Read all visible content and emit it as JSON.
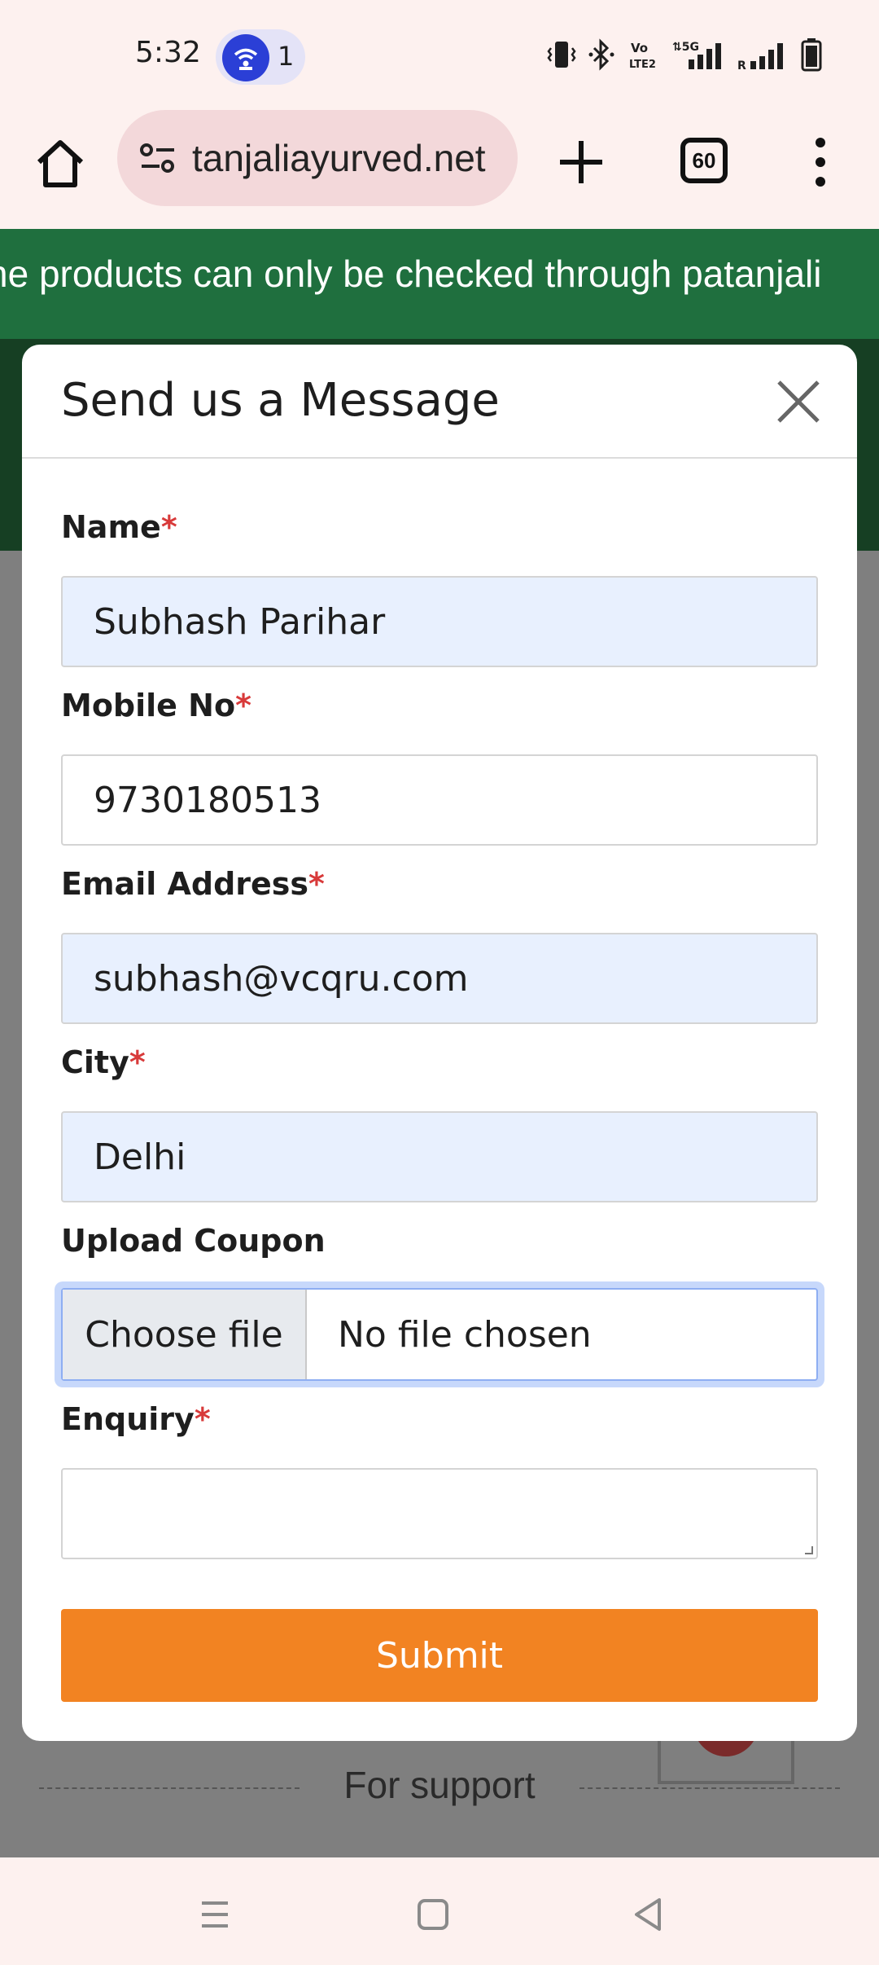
{
  "status_bar": {
    "time": "5:32",
    "hotspot_count": "1",
    "icons": [
      "vibrate-icon",
      "bluetooth-icon",
      "volte-icon",
      "5g-signal-icon",
      "signal-icon",
      "battery-icon"
    ]
  },
  "browser": {
    "url": "tanjaliayurved.net",
    "tab_count": "60"
  },
  "page": {
    "marquee_text": "ne products can only be checked through patanjali",
    "support_text": "For support"
  },
  "modal": {
    "title": "Send us a Message",
    "fields": {
      "name": {
        "label": "Name",
        "required_mark": "*",
        "value": "Subhash Parihar"
      },
      "mobile": {
        "label": "Mobile No",
        "required_mark": "*",
        "value": "9730180513"
      },
      "email": {
        "label": "Email Address",
        "required_mark": "*",
        "value": "subhash@vcqru.com"
      },
      "city": {
        "label": "City",
        "required_mark": "*",
        "value": "Delhi"
      },
      "coupon": {
        "label": "Upload Coupon",
        "button_label": "Choose file",
        "status": "No file chosen"
      },
      "enquiry": {
        "label": "Enquiry",
        "required_mark": "*",
        "value": ""
      }
    },
    "submit_label": "Submit"
  },
  "colors": {
    "banner_green": "#1f6f3e",
    "submit_orange": "#f28322",
    "autofill_blue": "#e8f0fe",
    "required_red": "#d83a3a"
  }
}
